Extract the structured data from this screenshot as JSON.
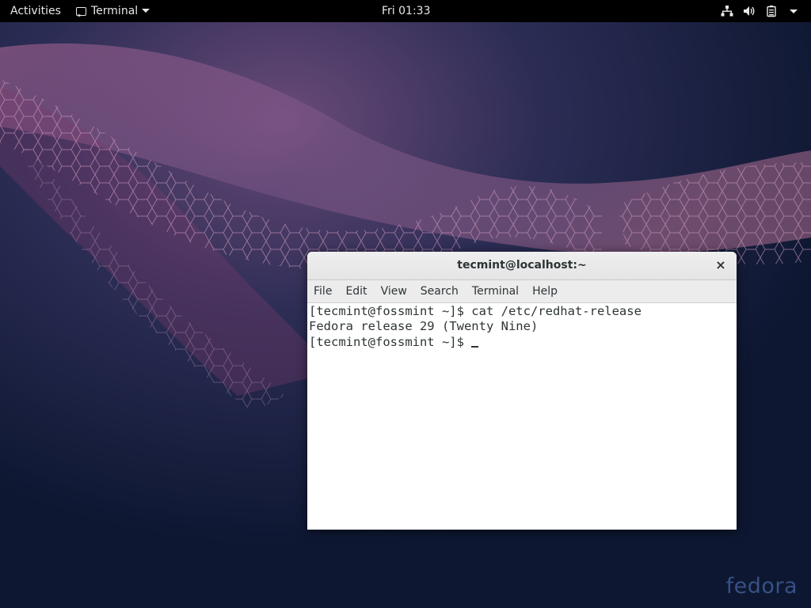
{
  "topbar": {
    "activities_label": "Activities",
    "app_menu_label": "Terminal",
    "clock": "Fri 01:33",
    "tray_icons": [
      "network-icon",
      "volume-icon",
      "battery-icon",
      "system-menu-caret-icon"
    ]
  },
  "terminal": {
    "title": "tecmint@localhost:~",
    "close_symbol": "×",
    "menu": [
      "File",
      "Edit",
      "View",
      "Search",
      "Terminal",
      "Help"
    ],
    "lines": [
      "[tecmint@fossmint ~]$ cat /etc/redhat-release",
      "Fedora release 29 (Twenty Nine)",
      "[tecmint@fossmint ~]$ "
    ]
  },
  "desktop": {
    "watermark": "fedora"
  },
  "colors": {
    "topbar_bg": "#000000",
    "terminal_text": "#2e3436",
    "wallpaper_dark": "#0e1a33",
    "wallpaper_pink": "#c0607f"
  }
}
